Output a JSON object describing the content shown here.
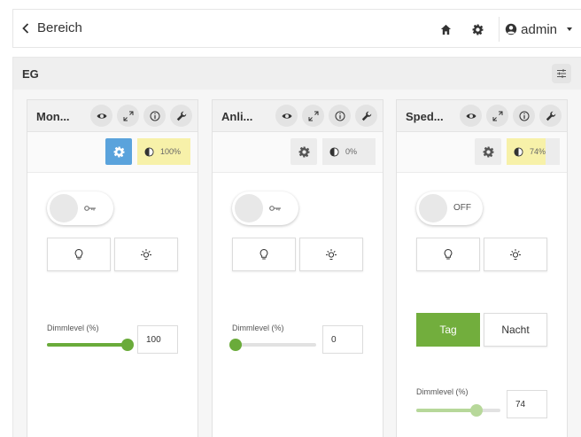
{
  "header": {
    "back_label": "Bereich",
    "user_label": "admin"
  },
  "section": {
    "title": "EG"
  },
  "cards": [
    {
      "title": "Mon...",
      "auto_active": true,
      "brightness_label": "100%",
      "brightness_percent": 100,
      "toggle_text": "",
      "dimm_label": "Dimmlevel (%)",
      "dimm_value": "100",
      "dimm_percent": 100
    },
    {
      "title": "Anli...",
      "auto_active": false,
      "brightness_label": "0%",
      "brightness_percent": 0,
      "toggle_text": "",
      "dimm_label": "Dimmlevel (%)",
      "dimm_value": "0",
      "dimm_percent": 0
    },
    {
      "title": "Sped...",
      "auto_active": false,
      "brightness_label": "74%",
      "brightness_percent": 74,
      "toggle_text": "OFF",
      "day_label": "Tag",
      "night_label": "Nacht",
      "dimm_label": "Dimmlevel (%)",
      "dimm_value": "74",
      "dimm_percent": 74
    }
  ],
  "colors": {
    "accent_green": "#72ae3d",
    "auto_blue": "#5aa3dc",
    "brightness_yellow": "#f7f1a9"
  },
  "icons": {
    "back": "chevron-left-icon",
    "home": "home-icon",
    "settings": "gear-icon",
    "user": "user-circle-icon",
    "filter": "sliders-icon",
    "visibility": "eye-icon",
    "expand": "expand-icon",
    "info": "info-icon",
    "tool": "wrench-icon",
    "brightness": "contrast-icon",
    "lamp": "bulb-icon",
    "sun": "sun-icon",
    "key": "key-icon"
  }
}
